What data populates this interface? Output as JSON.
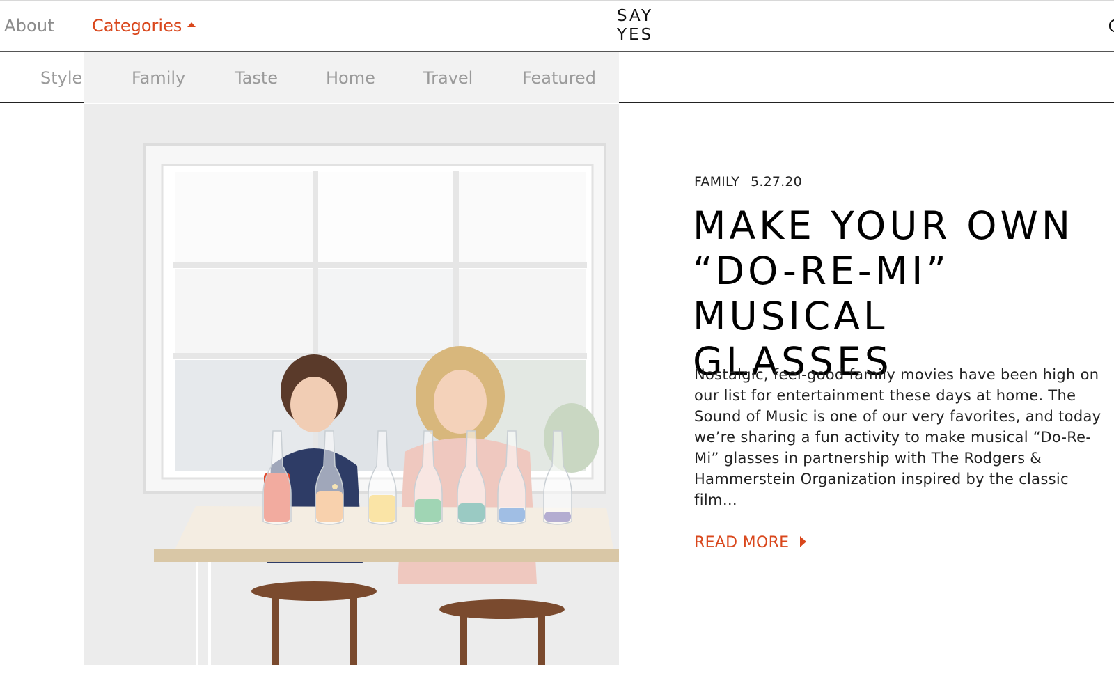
{
  "header": {
    "about_label": "About",
    "categories_label": "Categories",
    "logo_line1": "SAY",
    "logo_line2": "YES"
  },
  "subnav": {
    "items": [
      {
        "label": "Style"
      },
      {
        "label": "Family"
      },
      {
        "label": "Taste"
      },
      {
        "label": "Home"
      },
      {
        "label": "Travel"
      },
      {
        "label": "Featured"
      }
    ]
  },
  "post": {
    "category": "FAMILY",
    "date": "5.27.20",
    "title": "Make Your Own “Do-Re-Mi” Musical Glasses",
    "excerpt": "Nostalgic, feel-good family movies have been high on our list for entertainment these days at home. The Sound of Music is one of our very favorites, and today we’re sharing a fun activity to make musical “Do-Re-Mi” glasses in partnership with The Rodgers & Hammerstein Organization inspired by the classic film…",
    "read_more_label": "READ MORE",
    "image_alt": "Two children filling glass bottles with colored water at a table by a window",
    "bottle_colors": [
      "#e2462a",
      "#f09a4a",
      "#f3c33a",
      "#2ea25a",
      "#1f8a7a",
      "#2e6fc4",
      "#5a4a9a"
    ]
  },
  "colors": {
    "accent": "#d9471c",
    "nav_gray": "#8c8c8c",
    "subnav_bg": "#f2f2f2"
  }
}
